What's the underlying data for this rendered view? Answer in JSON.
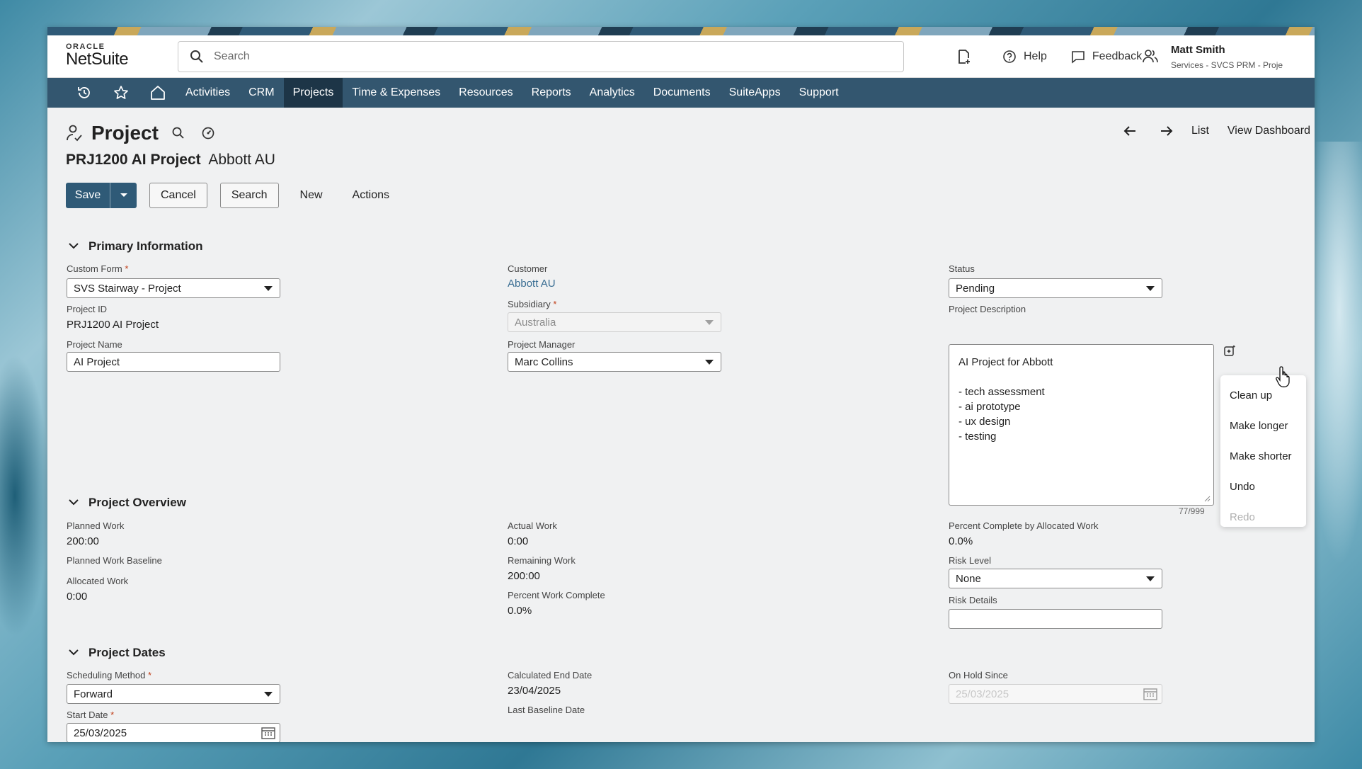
{
  "logo": {
    "oracle": "ORACLE",
    "netsuite": "NetSuite"
  },
  "search": {
    "placeholder": "Search"
  },
  "topbar": {
    "help": "Help",
    "feedback": "Feedback",
    "user_name": "Matt Smith",
    "user_role": "Services - SVCS PRM - Proje"
  },
  "nav": {
    "items": [
      "Activities",
      "CRM",
      "Projects",
      "Time & Expenses",
      "Resources",
      "Reports",
      "Analytics",
      "Documents",
      "SuiteApps",
      "Support"
    ],
    "active": "Projects"
  },
  "page": {
    "title": "Project",
    "record_id": "PRJ1200 AI Project",
    "record_customer": "Abbott AU",
    "right_nav": {
      "list": "List",
      "dashboard": "View Dashboard"
    }
  },
  "buttons": {
    "save": "Save",
    "cancel": "Cancel",
    "search": "Search",
    "new": "New",
    "actions": "Actions"
  },
  "primary": {
    "title": "Primary Information",
    "custom_form_label": "Custom Form",
    "custom_form_value": "SVS Stairway - Project",
    "project_id_label": "Project ID",
    "project_id_value": "PRJ1200 AI Project",
    "project_name_label": "Project Name",
    "project_name_value": "AI Project",
    "customer_label": "Customer",
    "customer_value": "Abbott AU",
    "subsidiary_label": "Subsidiary",
    "subsidiary_value": "Australia",
    "manager_label": "Project Manager",
    "manager_value": "Marc Collins",
    "status_label": "Status",
    "status_value": "Pending",
    "description_label": "Project Description",
    "description_lines": [
      "AI Project for Abbott",
      "",
      "- tech assessment",
      "- ai prototype",
      "- ux design",
      "- testing"
    ],
    "description_counter": "77/999"
  },
  "ai_menu": {
    "items": [
      "Clean up",
      "Make longer",
      "Make shorter",
      "Undo",
      "Redo"
    ],
    "disabled": [
      "Redo"
    ]
  },
  "overview": {
    "title": "Project Overview",
    "planned_work_label": "Planned Work",
    "planned_work_value": "200:00",
    "planned_baseline_label": "Planned Work Baseline",
    "allocated_label": "Allocated Work",
    "allocated_value": "0:00",
    "actual_label": "Actual Work",
    "actual_value": "0:00",
    "remaining_label": "Remaining Work",
    "remaining_value": "200:00",
    "percent_work_label": "Percent Work Complete",
    "percent_work_value": "0.0%",
    "percent_alloc_label": "Percent Complete by Allocated Work",
    "percent_alloc_value": "0.0%",
    "risk_level_label": "Risk Level",
    "risk_level_value": "None",
    "risk_details_label": "Risk Details"
  },
  "dates": {
    "title": "Project Dates",
    "scheduling_label": "Scheduling Method",
    "scheduling_value": "Forward",
    "start_label": "Start Date",
    "start_value": "25/03/2025",
    "calc_end_label": "Calculated End Date",
    "calc_end_value": "23/04/2025",
    "last_baseline_label": "Last Baseline Date",
    "on_hold_label": "On Hold Since",
    "on_hold_placeholder": "25/03/2025"
  }
}
